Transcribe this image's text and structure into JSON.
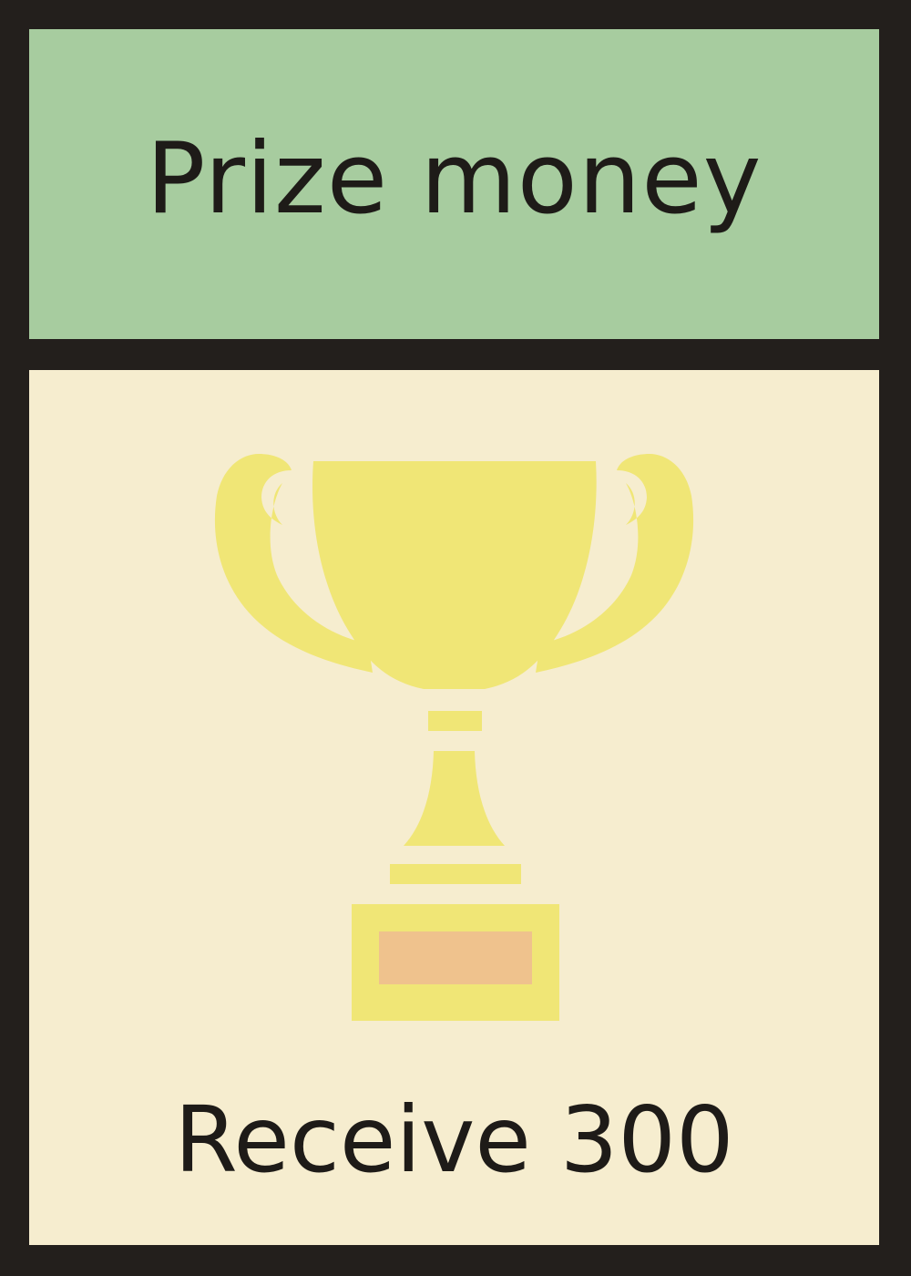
{
  "card": {
    "title": "Prize money",
    "action": "Receive 300",
    "icon": "trophy-icon"
  },
  "colors": {
    "border": "#231f1c",
    "header_background": "#a7cc9f",
    "body_background": "#f6edcf",
    "trophy": "#f0e676",
    "plaque": "#efc28d",
    "text": "#1e1b18"
  }
}
